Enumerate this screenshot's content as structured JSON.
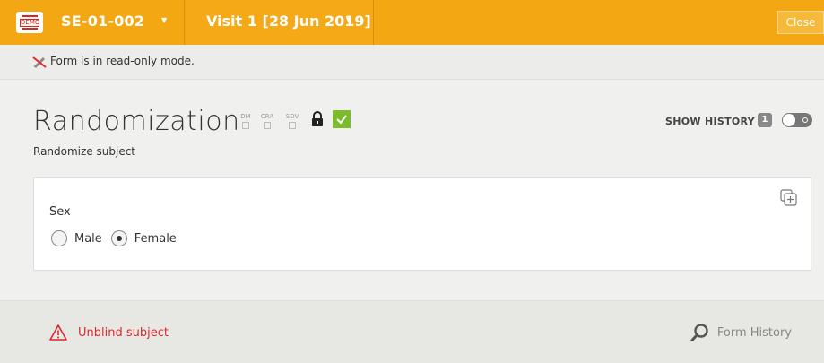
{
  "header": {
    "subject_id": "SE-01-002",
    "visit": "Visit 1 [28 Jun 2019]",
    "close_label": "Close",
    "demo_badge": "DEMO"
  },
  "notice": {
    "readonly_text": "Form is in read-only mode."
  },
  "form": {
    "title": "Randomization",
    "subtitle": "Randomize subject",
    "flags": [
      "DM",
      "CRA",
      "SDV"
    ],
    "status_color": "#7cbc2a",
    "show_history_label": "SHOW HISTORY",
    "history_count": "1"
  },
  "field": {
    "label": "Sex",
    "options": [
      {
        "label": "Male",
        "selected": false
      },
      {
        "label": "Female",
        "selected": true
      }
    ]
  },
  "footer": {
    "unblind_label": "Unblind subject",
    "form_history_label": "Form History",
    "unblind_color": "#e0262c"
  },
  "colors": {
    "accent": "#f3a712"
  }
}
